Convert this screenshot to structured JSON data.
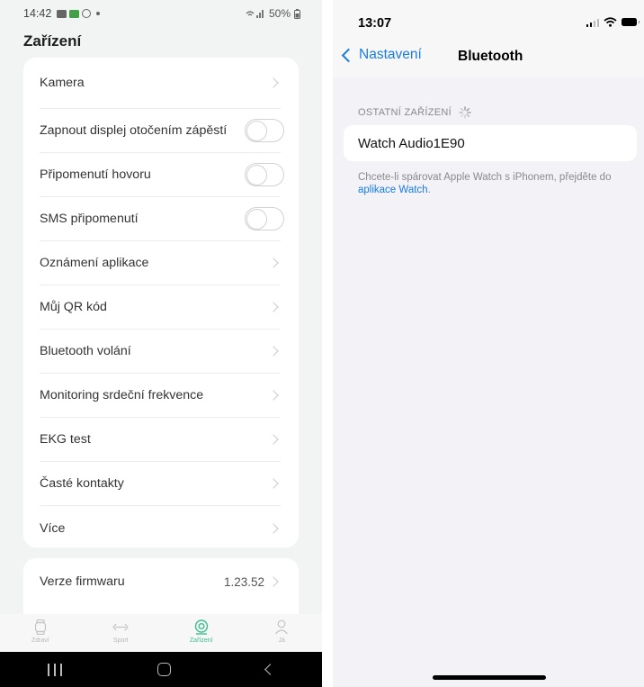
{
  "android": {
    "status": {
      "time": "14:42",
      "battery": "50%"
    },
    "title": "Zařízení",
    "items": [
      {
        "label": "Kamera",
        "control": "chevron"
      },
      {
        "label": "Zapnout displej otočením zápěstí",
        "control": "toggle",
        "on": false
      },
      {
        "label": "Připomenutí hovoru",
        "control": "toggle",
        "on": false
      },
      {
        "label": "SMS připomenutí",
        "control": "toggle",
        "on": false
      },
      {
        "label": "Oznámení aplikace",
        "control": "chevron"
      },
      {
        "label": "Můj QR kód",
        "control": "chevron"
      },
      {
        "label": "Bluetooth volání",
        "control": "chevron"
      },
      {
        "label": "Monitoring srdeční frekvence",
        "control": "chevron"
      },
      {
        "label": "EKG test",
        "control": "chevron"
      },
      {
        "label": "Časté kontakty",
        "control": "chevron"
      },
      {
        "label": "Více",
        "control": "chevron"
      }
    ],
    "firmware": {
      "label": "Verze firmwaru",
      "value": "1.23.52"
    },
    "tabs": [
      {
        "label": "Zdraví",
        "icon": "watch-icon",
        "active": false
      },
      {
        "label": "Sport",
        "icon": "dumbbell-icon",
        "active": false
      },
      {
        "label": "Zařízení",
        "icon": "device-icon",
        "active": true
      },
      {
        "label": "Já",
        "icon": "person-icon",
        "active": false
      }
    ],
    "accent": "#3bbf8f"
  },
  "ios": {
    "status": {
      "time": "13:07"
    },
    "back_label": "Nastavení",
    "title": "Bluetooth",
    "section_header": "OSTATNÍ ZAŘÍZENÍ",
    "devices": [
      {
        "name": "Watch Audio1E90"
      }
    ],
    "footer_text": "Chcete-li spárovat Apple Watch s iPhonem, přejděte do ",
    "footer_link": "aplikace Watch",
    "footer_end": ".",
    "accent": "#1a7ce0"
  }
}
